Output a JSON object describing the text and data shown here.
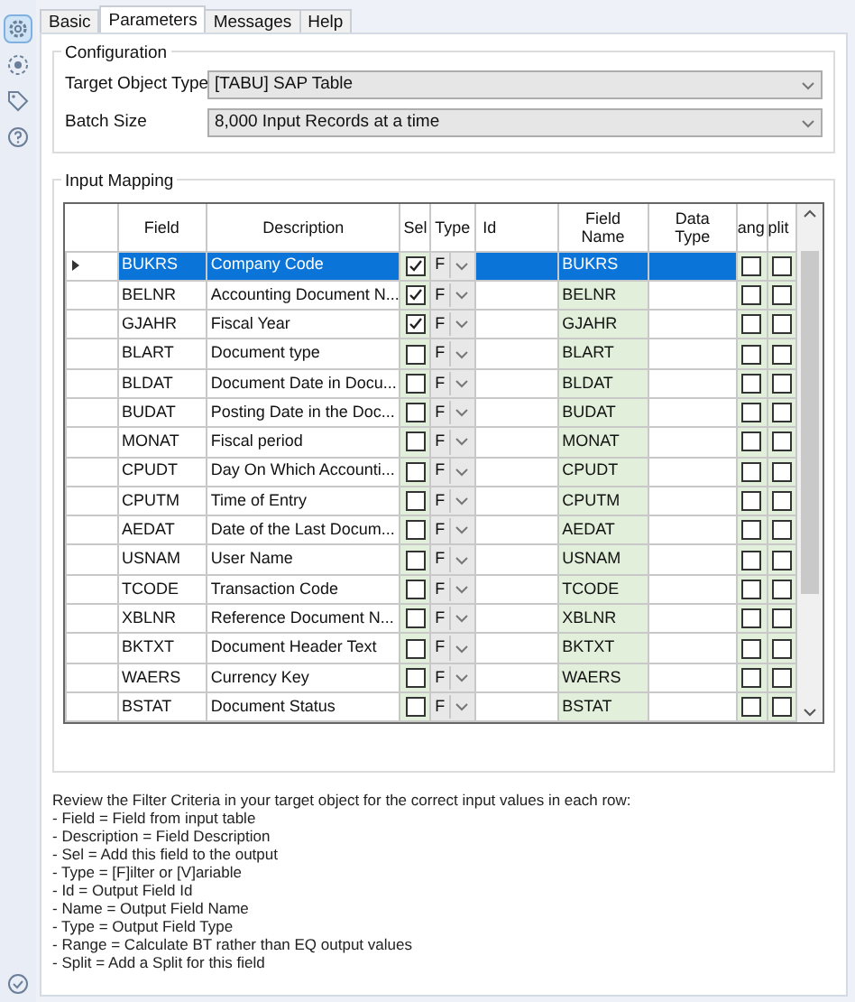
{
  "sidebar": {
    "items": [
      {
        "kind": "settings",
        "selected": true
      },
      {
        "kind": "target",
        "selected": false
      },
      {
        "kind": "tag",
        "selected": false
      },
      {
        "kind": "help",
        "selected": false
      }
    ],
    "footer": {
      "kind": "check"
    }
  },
  "tabs": [
    {
      "label": "Basic",
      "selected": false
    },
    {
      "label": "Parameters",
      "selected": true
    },
    {
      "label": "Messages",
      "selected": false
    },
    {
      "label": "Help",
      "selected": false
    }
  ],
  "configuration": {
    "title": "Configuration",
    "fields": [
      {
        "label": "Target Object Type",
        "value": "[TABU] SAP Table"
      },
      {
        "label": "Batch Size",
        "value": "8,000 Input Records at a time"
      }
    ]
  },
  "input_mapping": {
    "title": "Input Mapping",
    "columns": [
      "Field",
      "Description",
      "Sel",
      "Type",
      "Id",
      "Field Name",
      "Data Type",
      "ang",
      "plit"
    ],
    "rows": [
      {
        "field": "BUKRS",
        "description": "Company Code",
        "sel": true,
        "type": "F",
        "field_name": "BUKRS",
        "range": false,
        "split": false,
        "selected": true
      },
      {
        "field": "BELNR",
        "description": "Accounting Document N...",
        "sel": true,
        "type": "F",
        "field_name": "BELNR",
        "range": false,
        "split": false,
        "selected": false
      },
      {
        "field": "GJAHR",
        "description": "Fiscal Year",
        "sel": true,
        "type": "F",
        "field_name": "GJAHR",
        "range": false,
        "split": false,
        "selected": false
      },
      {
        "field": "BLART",
        "description": "Document type",
        "sel": false,
        "type": "F",
        "field_name": "BLART",
        "range": false,
        "split": false,
        "selected": false
      },
      {
        "field": "BLDAT",
        "description": "Document Date in Docu...",
        "sel": false,
        "type": "F",
        "field_name": "BLDAT",
        "range": false,
        "split": false,
        "selected": false
      },
      {
        "field": "BUDAT",
        "description": "Posting Date in the Doc...",
        "sel": false,
        "type": "F",
        "field_name": "BUDAT",
        "range": false,
        "split": false,
        "selected": false
      },
      {
        "field": "MONAT",
        "description": "Fiscal period",
        "sel": false,
        "type": "F",
        "field_name": "MONAT",
        "range": false,
        "split": false,
        "selected": false
      },
      {
        "field": "CPUDT",
        "description": "Day On Which Accounti...",
        "sel": false,
        "type": "F",
        "field_name": "CPUDT",
        "range": false,
        "split": false,
        "selected": false
      },
      {
        "field": "CPUTM",
        "description": "Time of Entry",
        "sel": false,
        "type": "F",
        "field_name": "CPUTM",
        "range": false,
        "split": false,
        "selected": false
      },
      {
        "field": "AEDAT",
        "description": "Date of the Last Docum...",
        "sel": false,
        "type": "F",
        "field_name": "AEDAT",
        "range": false,
        "split": false,
        "selected": false
      },
      {
        "field": "USNAM",
        "description": "User Name",
        "sel": false,
        "type": "F",
        "field_name": "USNAM",
        "range": false,
        "split": false,
        "selected": false
      },
      {
        "field": "TCODE",
        "description": "Transaction Code",
        "sel": false,
        "type": "F",
        "field_name": "TCODE",
        "range": false,
        "split": false,
        "selected": false
      },
      {
        "field": "XBLNR",
        "description": "Reference Document N...",
        "sel": false,
        "type": "F",
        "field_name": "XBLNR",
        "range": false,
        "split": false,
        "selected": false
      },
      {
        "field": "BKTXT",
        "description": "Document Header Text",
        "sel": false,
        "type": "F",
        "field_name": "BKTXT",
        "range": false,
        "split": false,
        "selected": false
      },
      {
        "field": "WAERS",
        "description": "Currency Key",
        "sel": false,
        "type": "F",
        "field_name": "WAERS",
        "range": false,
        "split": false,
        "selected": false
      },
      {
        "field": "BSTAT",
        "description": "Document Status",
        "sel": false,
        "type": "F",
        "field_name": "BSTAT",
        "range": false,
        "split": false,
        "selected": false
      }
    ]
  },
  "help_text": [
    "Review the Filter Criteria in your target object for the correct input values in each row:",
    "- Field = Field from input table",
    "- Description = Field Description",
    "- Sel = Add this field to the output",
    "- Type = [F]ilter or [V]ariable",
    "- Id = Output Field Id",
    "- Name = Output Field Name",
    "- Type = Output Field Type",
    "- Range = Calculate BT rather than EQ output values",
    "- Split = Add a Split for this field"
  ]
}
